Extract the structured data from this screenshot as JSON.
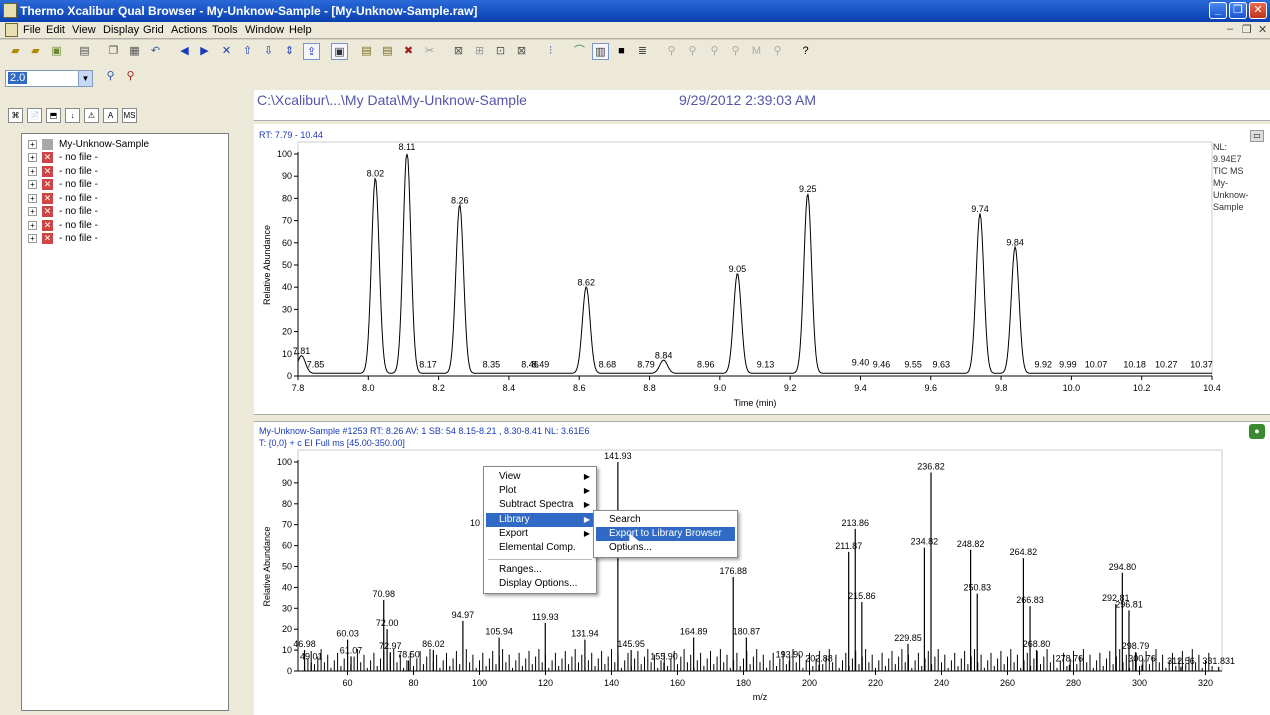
{
  "window": {
    "title": "Thermo Xcalibur Qual Browser - My-Unknow-Sample - [My-Unknow-Sample.raw]",
    "buttons": [
      "_",
      "❐",
      "✕"
    ]
  },
  "menubar": {
    "items": [
      "File",
      "Edit",
      "View",
      "Display",
      "Grid",
      "Actions",
      "Tools",
      "Window",
      "Help"
    ],
    "mdi_buttons": [
      "–",
      "❐",
      "✕"
    ]
  },
  "toolbar2": {
    "zoom_value": "2.0"
  },
  "left_tabs": [
    "⌘",
    "📄",
    "⬒",
    "↓",
    "⚠",
    "A",
    "MS"
  ],
  "tree": {
    "items": [
      {
        "label": "My-Unknow-Sample",
        "icon": "sample-icon"
      },
      {
        "label": "- no file -",
        "icon": "no-file-icon"
      },
      {
        "label": "- no file -",
        "icon": "no-file-icon"
      },
      {
        "label": "- no file -",
        "icon": "no-file-icon"
      },
      {
        "label": "- no file -",
        "icon": "no-file-icon"
      },
      {
        "label": "- no file -",
        "icon": "no-file-icon"
      },
      {
        "label": "- no file -",
        "icon": "no-file-icon"
      },
      {
        "label": "- no file -",
        "icon": "no-file-icon"
      }
    ]
  },
  "header": {
    "path": "C:\\Xcalibur\\...\\My Data\\My-Unknow-Sample",
    "datetime": "9/29/2012 2:39:03 AM"
  },
  "chromatogram": {
    "range_label": "RT: 7.79 - 10.44",
    "side_info": [
      "NL:",
      "9.94E7",
      "TIC  MS",
      "My-",
      "Unknow-",
      "Sample"
    ]
  },
  "spectrum": {
    "header_line1": "My-Unknow-Sample #1253   RT: 8.26   AV: 1   SB: 54  8.15-8.21 , 8.30-8.41   NL: 3.61E6",
    "header_line2": "T: {0,0}  + c EI Full ms [45.00-350.00]"
  },
  "context_menu": {
    "items": [
      {
        "label": "View",
        "submenu": true
      },
      {
        "label": "Plot",
        "submenu": true
      },
      {
        "label": "Subtract Spectra",
        "submenu": true
      },
      {
        "label": "Library",
        "submenu": true,
        "selected": true
      },
      {
        "label": "Export",
        "submenu": true
      },
      {
        "label": "Elemental Comp.",
        "submenu": false
      },
      {
        "label": "Ranges...",
        "submenu": false
      },
      {
        "label": "Display Options...",
        "submenu": false
      }
    ],
    "submenu_arrow": "▶"
  },
  "library_submenu": {
    "items": [
      {
        "label": "Search",
        "selected": false
      },
      {
        "label": "Export to Library Browser",
        "selected": true
      },
      {
        "label": "Options...",
        "selected": false
      }
    ]
  },
  "chart_data": [
    {
      "type": "line",
      "title": "RT: 7.79 - 10.44",
      "xlabel": "Time (min)",
      "ylabel": "Relative Abundance",
      "xlim": [
        7.8,
        10.4
      ],
      "ylim": [
        0,
        100
      ],
      "xticks": [
        7.8,
        8.0,
        8.2,
        8.4,
        8.6,
        8.8,
        9.0,
        9.2,
        9.4,
        9.6,
        9.8,
        10.0,
        10.2,
        10.4
      ],
      "yticks": [
        0,
        10,
        20,
        30,
        40,
        50,
        60,
        70,
        80,
        90,
        100
      ],
      "peaks": [
        {
          "x": 7.81,
          "y": 8,
          "label": "7.81"
        },
        {
          "x": 7.85,
          "y": 2,
          "label": "7.85"
        },
        {
          "x": 8.02,
          "y": 88,
          "label": "8.02"
        },
        {
          "x": 8.11,
          "y": 100,
          "label": "8.11"
        },
        {
          "x": 8.17,
          "y": 2,
          "label": "8.17"
        },
        {
          "x": 8.26,
          "y": 76,
          "label": "8.26"
        },
        {
          "x": 8.35,
          "y": 2,
          "label": "8.35"
        },
        {
          "x": 8.46,
          "y": 2,
          "label": "8.46"
        },
        {
          "x": 8.49,
          "y": 2,
          "label": "8.49"
        },
        {
          "x": 8.62,
          "y": 39,
          "label": "8.62"
        },
        {
          "x": 8.68,
          "y": 2,
          "label": "8.68"
        },
        {
          "x": 8.79,
          "y": 2,
          "label": "8.79"
        },
        {
          "x": 8.84,
          "y": 6,
          "label": "8.84"
        },
        {
          "x": 8.96,
          "y": 2,
          "label": "8.96"
        },
        {
          "x": 9.05,
          "y": 45,
          "label": "9.05"
        },
        {
          "x": 9.13,
          "y": 2,
          "label": "9.13"
        },
        {
          "x": 9.25,
          "y": 81,
          "label": "9.25"
        },
        {
          "x": 9.4,
          "y": 3,
          "label": "9.40"
        },
        {
          "x": 9.46,
          "y": 2,
          "label": "9.46"
        },
        {
          "x": 9.55,
          "y": 2,
          "label": "9.55"
        },
        {
          "x": 9.63,
          "y": 2,
          "label": "9.63"
        },
        {
          "x": 9.74,
          "y": 72,
          "label": "9.74"
        },
        {
          "x": 9.84,
          "y": 57,
          "label": "9.84"
        },
        {
          "x": 9.92,
          "y": 2,
          "label": "9.92"
        },
        {
          "x": 9.99,
          "y": 2,
          "label": "9.99"
        },
        {
          "x": 10.07,
          "y": 2,
          "label": "10.07"
        },
        {
          "x": 10.18,
          "y": 2,
          "label": "10.18"
        },
        {
          "x": 10.27,
          "y": 2,
          "label": "10.27"
        },
        {
          "x": 10.37,
          "y": 2,
          "label": "10.37"
        }
      ]
    },
    {
      "type": "bar",
      "xlabel": "m/z",
      "ylabel": "Relative Abundance",
      "xlim": [
        45,
        325
      ],
      "ylim": [
        0,
        100
      ],
      "xticks": [
        60,
        80,
        100,
        120,
        140,
        160,
        180,
        200,
        220,
        240,
        260,
        280,
        300,
        320
      ],
      "yticks": [
        0,
        10,
        20,
        30,
        40,
        50,
        60,
        70,
        80,
        90,
        100
      ],
      "labeled_peaks": [
        {
          "x": 46.98,
          "y": 10
        },
        {
          "x": 49.01,
          "y": 4
        },
        {
          "x": 60.03,
          "y": 15
        },
        {
          "x": 61.07,
          "y": 7
        },
        {
          "x": 70.98,
          "y": 34
        },
        {
          "x": 72.0,
          "y": 20
        },
        {
          "x": 72.97,
          "y": 9
        },
        {
          "x": 78.5,
          "y": 5
        },
        {
          "x": 86.02,
          "y": 10
        },
        {
          "x": 94.97,
          "y": 24
        },
        {
          "x": 105.94,
          "y": 16
        },
        {
          "x": 119.93,
          "y": 23
        },
        {
          "x": 131.94,
          "y": 15
        },
        {
          "x": 141.93,
          "y": 100
        },
        {
          "x": 145.95,
          "y": 10
        },
        {
          "x": 155.9,
          "y": 4
        },
        {
          "x": 164.89,
          "y": 16
        },
        {
          "x": 176.88,
          "y": 45
        },
        {
          "x": 180.87,
          "y": 16
        },
        {
          "x": 193.9,
          "y": 5
        },
        {
          "x": 202.88,
          "y": 3
        },
        {
          "x": 211.87,
          "y": 57
        },
        {
          "x": 213.86,
          "y": 68
        },
        {
          "x": 215.86,
          "y": 33
        },
        {
          "x": 229.85,
          "y": 13
        },
        {
          "x": 234.82,
          "y": 59
        },
        {
          "x": 236.82,
          "y": 95
        },
        {
          "x": 248.82,
          "y": 58
        },
        {
          "x": 250.83,
          "y": 37
        },
        {
          "x": 264.82,
          "y": 54
        },
        {
          "x": 266.83,
          "y": 31
        },
        {
          "x": 268.8,
          "y": 10
        },
        {
          "x": 278.76,
          "y": 3
        },
        {
          "x": 292.81,
          "y": 32
        },
        {
          "x": 294.8,
          "y": 47
        },
        {
          "x": 296.81,
          "y": 29
        },
        {
          "x": 298.79,
          "y": 9
        },
        {
          "x": 300.76,
          "y": 3
        },
        {
          "x": 312.56,
          "y": 2
        },
        {
          "x": 331.831,
          "y": 2
        }
      ],
      "peak_labels": [
        "46.98",
        "49.01",
        "60.03",
        "61.07",
        "70.98",
        "72.00",
        "72.97",
        "78.50",
        "86.02",
        "94.97",
        "105.94",
        "119.93",
        "131.94",
        "141.93",
        "145.95",
        "155.90",
        "164.89",
        "176.88",
        "180.87",
        "193.90",
        "202.88",
        "211.87",
        "213.86",
        "215.86",
        "229.85",
        "234.82",
        "236.82",
        "248.82",
        "250.83",
        "264.82",
        "266.83",
        "268.80",
        "278.76",
        "292.81",
        "294.80",
        "296.81",
        "298.79",
        "300.76",
        "312.56",
        "331.831"
      ],
      "partial_label": "10"
    }
  ]
}
